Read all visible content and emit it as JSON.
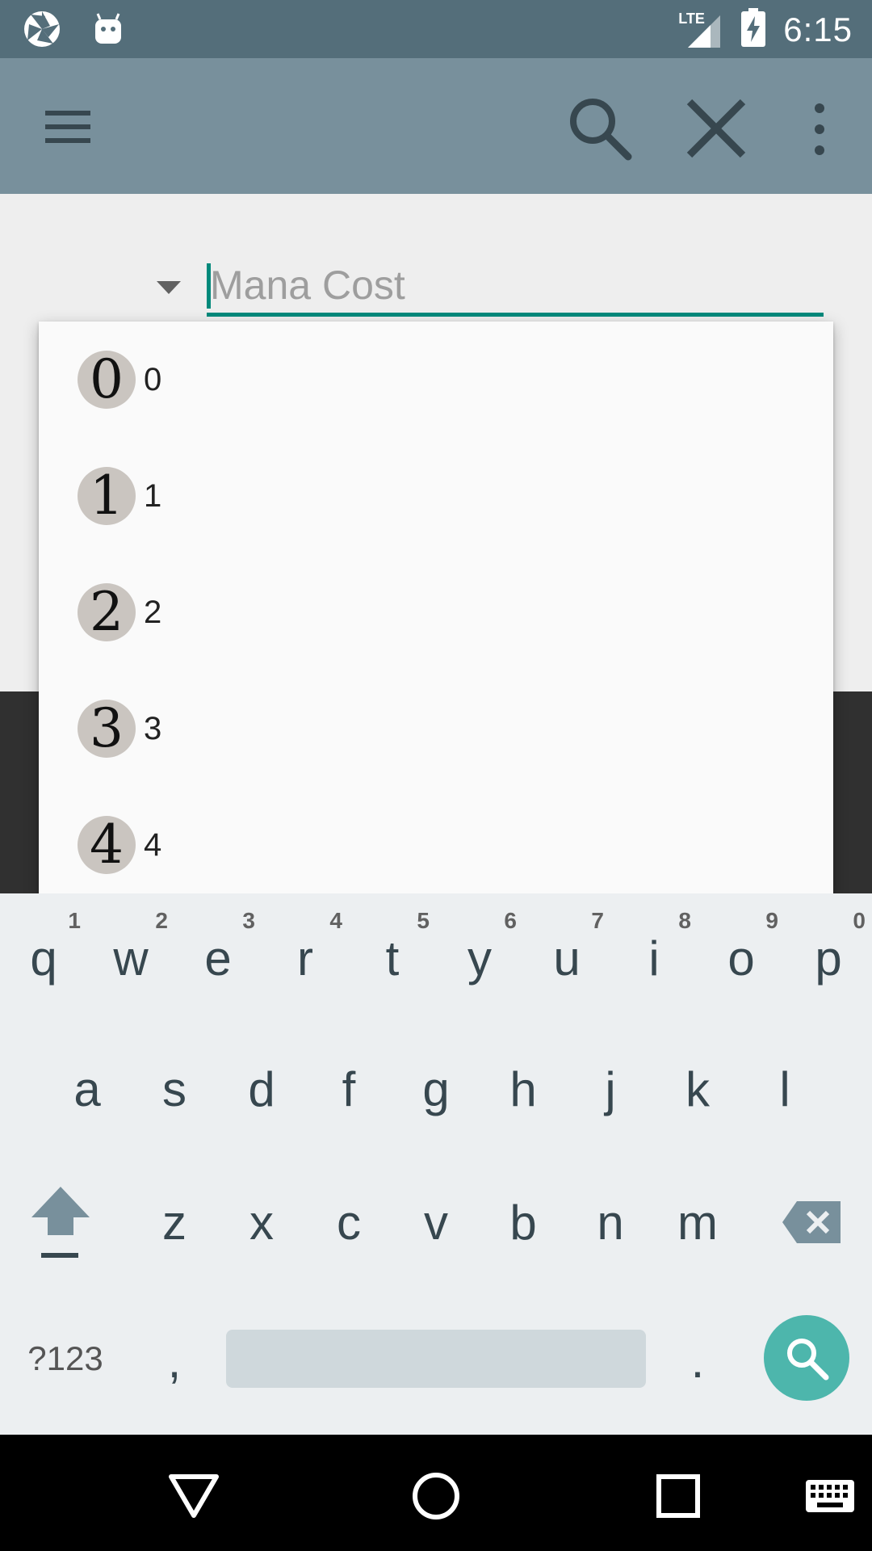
{
  "status_bar": {
    "time": "6:15",
    "network": "LTE",
    "icons": [
      "app-pinwheel-icon",
      "android-icon",
      "lte-signal-icon",
      "battery-charging-icon"
    ]
  },
  "app_bar": {
    "icons": [
      "menu-icon",
      "search-icon",
      "close-icon",
      "overflow-menu-icon"
    ],
    "color": "#78909c"
  },
  "search_field": {
    "placeholder": "Mana Cost",
    "value": "",
    "accent": "#00897b"
  },
  "dropdown": {
    "items": [
      {
        "symbol": "0",
        "label": "0"
      },
      {
        "symbol": "1",
        "label": "1"
      },
      {
        "symbol": "2",
        "label": "2"
      },
      {
        "symbol": "3",
        "label": "3"
      },
      {
        "symbol": "4",
        "label": "4"
      }
    ]
  },
  "keyboard": {
    "row1": [
      {
        "char": "q",
        "hint": "1"
      },
      {
        "char": "w",
        "hint": "2"
      },
      {
        "char": "e",
        "hint": "3"
      },
      {
        "char": "r",
        "hint": "4"
      },
      {
        "char": "t",
        "hint": "5"
      },
      {
        "char": "y",
        "hint": "6"
      },
      {
        "char": "u",
        "hint": "7"
      },
      {
        "char": "i",
        "hint": "8"
      },
      {
        "char": "o",
        "hint": "9"
      },
      {
        "char": "p",
        "hint": "0"
      }
    ],
    "row2": [
      "a",
      "s",
      "d",
      "f",
      "g",
      "h",
      "j",
      "k",
      "l"
    ],
    "row3": [
      "z",
      "x",
      "c",
      "v",
      "b",
      "n",
      "m"
    ],
    "symbols_label": "?123",
    "comma": ",",
    "period": ".",
    "search_key_color": "#4db6ac"
  },
  "nav_bar": {
    "icons": [
      "back-icon",
      "home-icon",
      "recents-icon",
      "keyboard-icon"
    ]
  }
}
